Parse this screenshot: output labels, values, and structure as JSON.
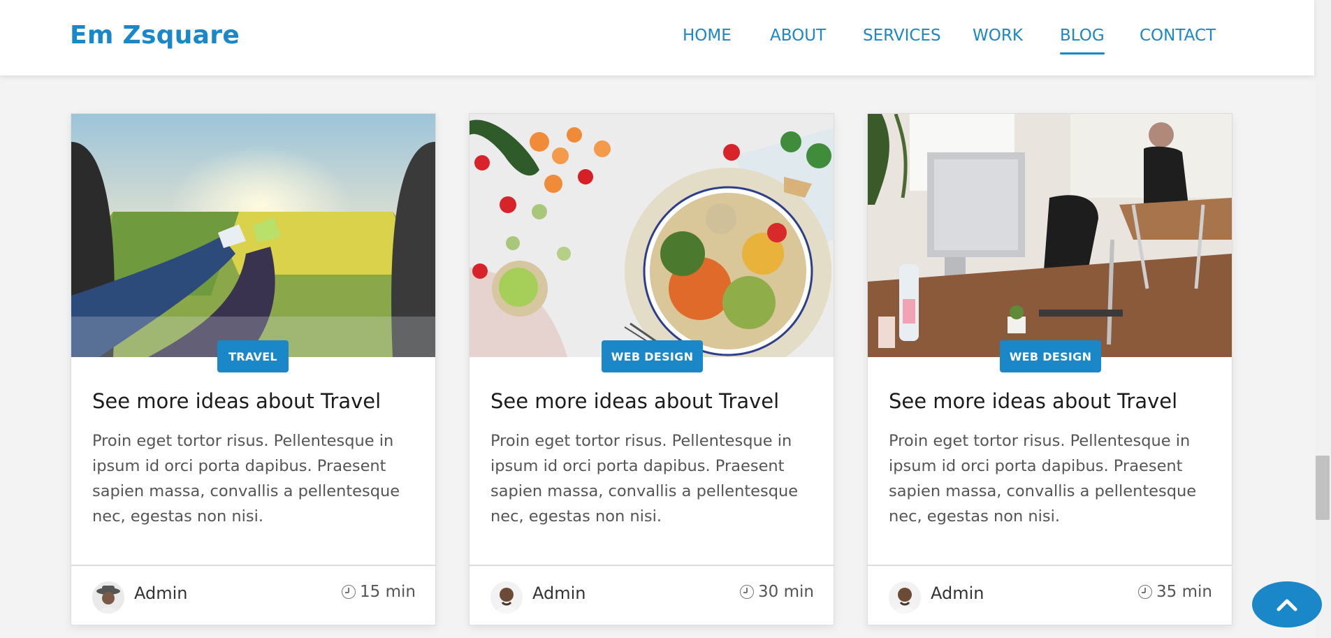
{
  "header": {
    "brand": "Em Zsquare",
    "nav": [
      {
        "label": "HOME"
      },
      {
        "label": "ABOUT"
      },
      {
        "label": "SERVICES"
      },
      {
        "label": "WORK"
      },
      {
        "label": "BLOG",
        "active": true
      },
      {
        "label": "CONTACT"
      }
    ]
  },
  "cards": [
    {
      "image_icon": "travel-photo",
      "badge": "TRAVEL",
      "title": "See more ideas about Travel",
      "text": "Proin eget tortor risus. Pellentesque in ipsum id orci porta dapibus. Praesent sapien massa, convallis a pellentesque nec, egestas non nisi.",
      "author": "Admin",
      "time": "15 min"
    },
    {
      "image_icon": "food-bowl-photo",
      "badge": "WEB DESIGN",
      "title": "See more ideas about Travel",
      "text": "Proin eget tortor risus. Pellentesque in ipsum id orci porta dapibus. Praesent sapien massa, convallis a pellentesque nec, egestas non nisi.",
      "author": "Admin",
      "time": "30 min"
    },
    {
      "image_icon": "office-desk-photo",
      "badge": "WEB DESIGN",
      "title": "See more ideas about Travel",
      "text": "Proin eget tortor risus. Pellentesque in ipsum id orci porta dapibus. Praesent sapien massa, convallis a pellentesque nec, egestas non nisi.",
      "author": "Admin",
      "time": "35 min"
    }
  ],
  "colors": {
    "accent": "#1a87c9",
    "background": "#f3f3f3"
  }
}
